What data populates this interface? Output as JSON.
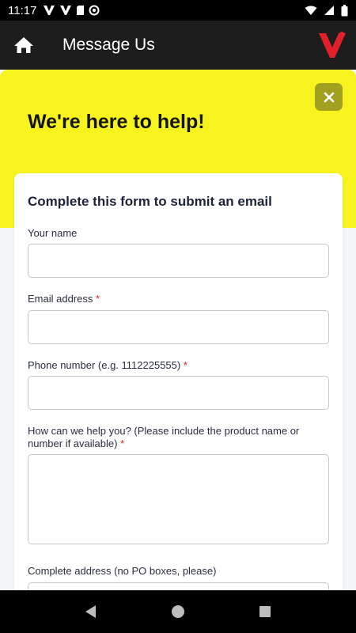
{
  "status_bar": {
    "time": "11:17",
    "left_icons": [
      "v-logo-icon",
      "v-logo-icon",
      "sd-card-icon",
      "sync-icon"
    ],
    "right_icons": [
      "wifi-icon",
      "signal-icon",
      "battery-icon"
    ]
  },
  "app_bar": {
    "title": "Message Us",
    "home_icon": "home-icon",
    "brand_icon": "brand-v-logo-icon",
    "brand_color": "#e0202a"
  },
  "hero": {
    "title": "We're here to help!",
    "background_color": "#f7f31f",
    "close_icon": "close-icon"
  },
  "form": {
    "heading": "Complete this form to submit an email",
    "fields": [
      {
        "label": "Your name",
        "required": false,
        "value": "",
        "type": "text"
      },
      {
        "label": "Email address",
        "required": true,
        "value": "",
        "type": "email"
      },
      {
        "label": "Phone number (e.g. 1112225555)",
        "required": true,
        "value": "",
        "type": "tel"
      },
      {
        "label": "How can we help you? (Please include the product name or number if available)",
        "required": true,
        "value": "",
        "type": "textarea"
      },
      {
        "label": "Complete address (no PO boxes, please)",
        "required": false,
        "value": "",
        "type": "text"
      }
    ],
    "required_marker": "*"
  },
  "nav_bar": {
    "buttons": [
      "back-icon",
      "home-circle-icon",
      "recents-icon"
    ]
  }
}
